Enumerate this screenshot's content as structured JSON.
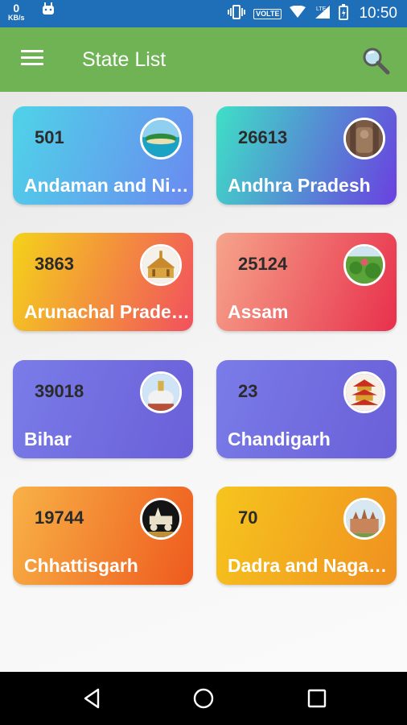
{
  "status_bar": {
    "speed_value": "0",
    "speed_unit": "KB/s",
    "network_badge": "VOLTE",
    "time": "10:50"
  },
  "app_bar": {
    "title": "State List"
  },
  "states": [
    {
      "count": "501",
      "name": "Andaman and Ni…",
      "gradient": [
        "#4fd3e8",
        "#6a8af0"
      ],
      "icon": "island-photo"
    },
    {
      "count": "26613",
      "name": "Andhra Pradesh",
      "gradient": [
        "#3ee0c6",
        "#6a40e0"
      ],
      "icon": "temple-carving-photo"
    },
    {
      "count": "3863",
      "name": "Arunachal Pradesh",
      "gradient": [
        "#f4d21a",
        "#f2505e"
      ],
      "icon": "monastery-photo"
    },
    {
      "count": "25124",
      "name": "Assam",
      "gradient": [
        "#f6a48a",
        "#e8304c"
      ],
      "icon": "tea-garden-photo"
    },
    {
      "count": "39018",
      "name": "Bihar",
      "gradient": [
        "#7a7ce8",
        "#6a5fd8"
      ],
      "icon": "stupa-photo"
    },
    {
      "count": "23",
      "name": "Chandigarh",
      "gradient": [
        "#7a7ce8",
        "#6a5fd8"
      ],
      "icon": "pagoda-photo"
    },
    {
      "count": "19744",
      "name": "Chhattisgarh",
      "gradient": [
        "#f8b246",
        "#ee5a1e"
      ],
      "icon": "chariot-statue-photo"
    },
    {
      "count": "70",
      "name": "Dadra and Nagar…",
      "gradient": [
        "#f6c51e",
        "#f09020"
      ],
      "icon": "fort-photo"
    }
  ],
  "nav": {
    "back_icon": "back-triangle-icon",
    "home_icon": "home-circle-icon",
    "recents_icon": "recents-square-icon"
  }
}
